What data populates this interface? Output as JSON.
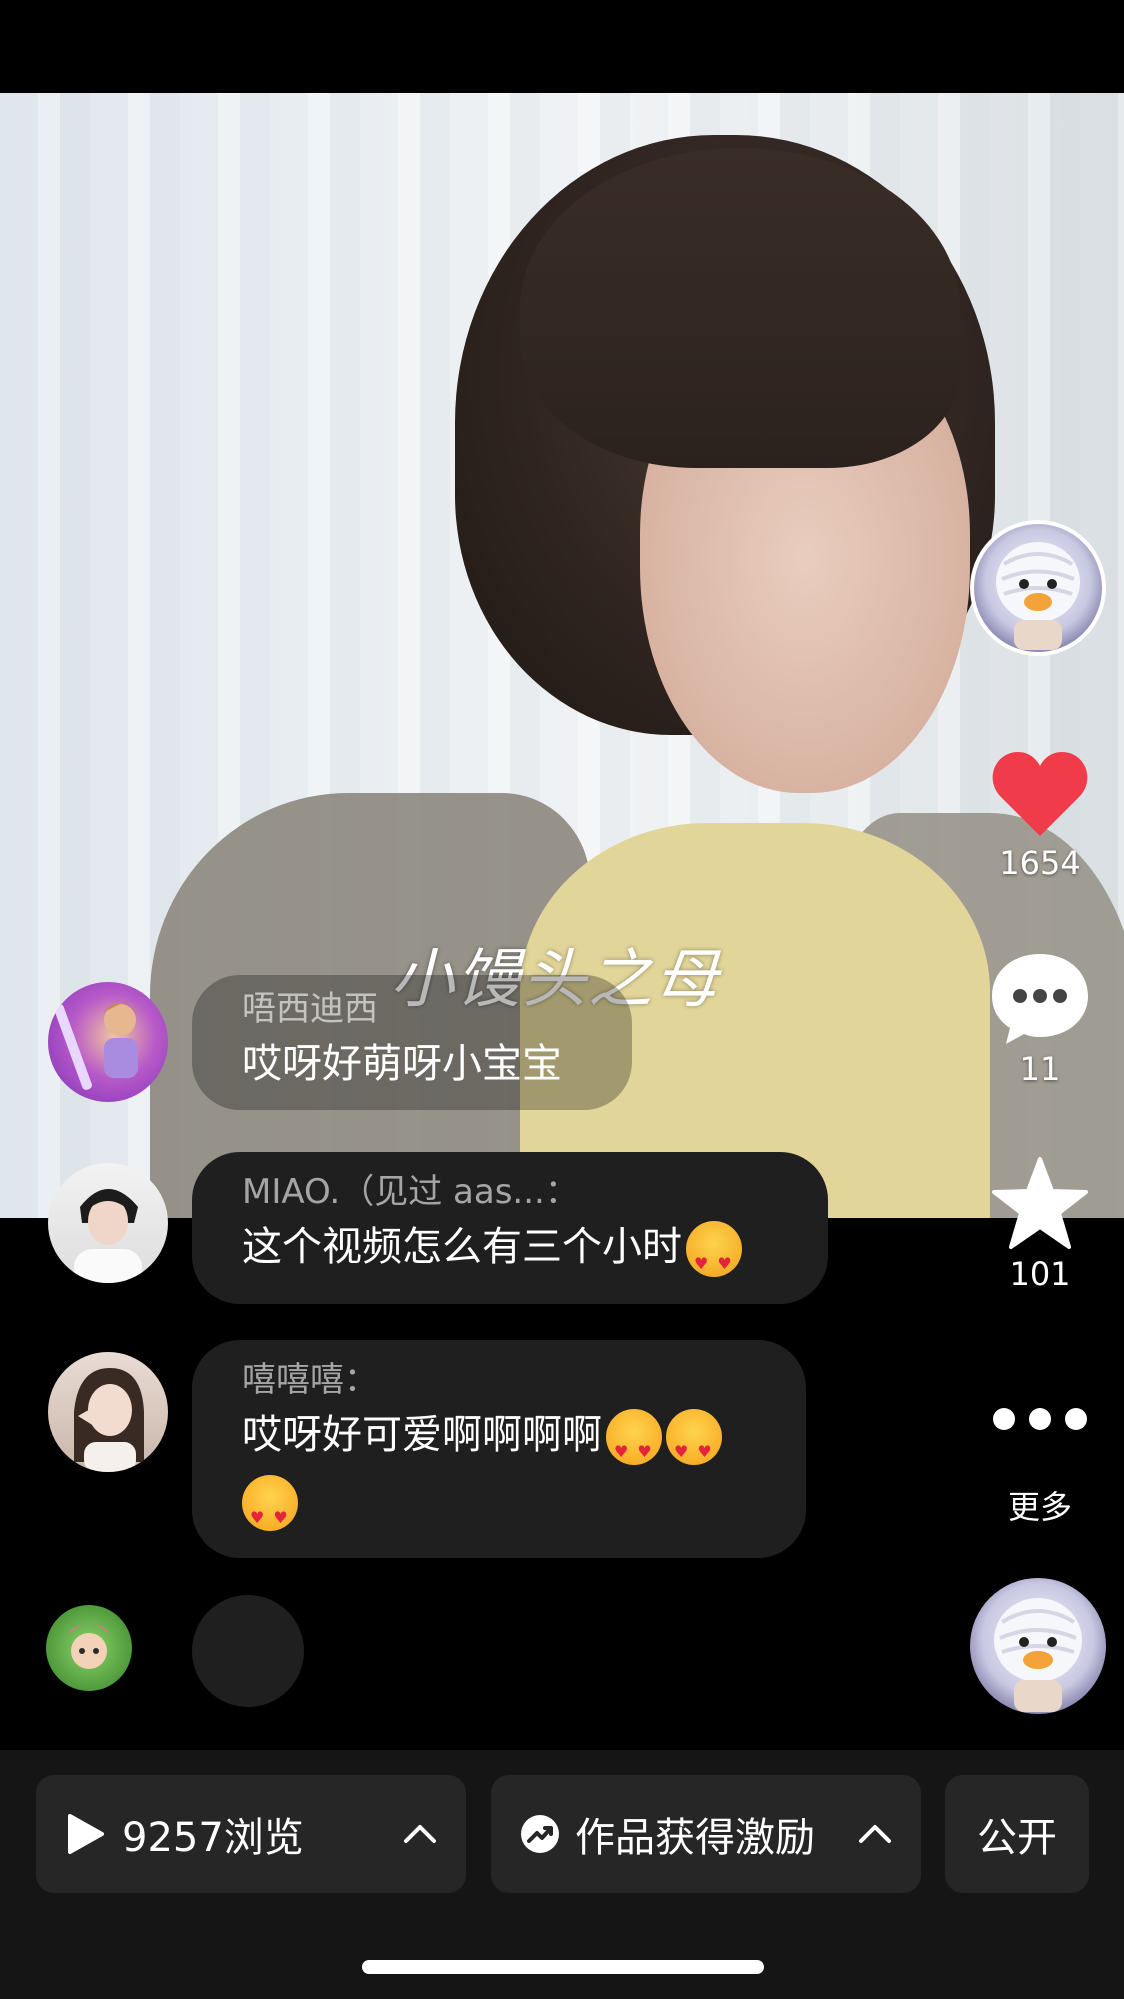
{
  "video": {
    "watermark": "小馒头之母"
  },
  "rail": {
    "like_count": "1654",
    "comment_count": "11",
    "favorite_count": "101",
    "more_label": "更多",
    "colors": {
      "like": "#ef3b4a"
    }
  },
  "comments": [
    {
      "user": "唔西迪西",
      "text": "哎呀好萌呀小宝宝"
    },
    {
      "user": "MIAO.（见过 aas...：",
      "text": "这个视频怎么有三个小时"
    },
    {
      "user": "嘻嘻嘻：",
      "text": "哎呀好可爱啊啊啊啊"
    }
  ],
  "bottom": {
    "views_label": "9257浏览",
    "incentive_label": "作品获得激励",
    "visibility_label": "公开"
  }
}
